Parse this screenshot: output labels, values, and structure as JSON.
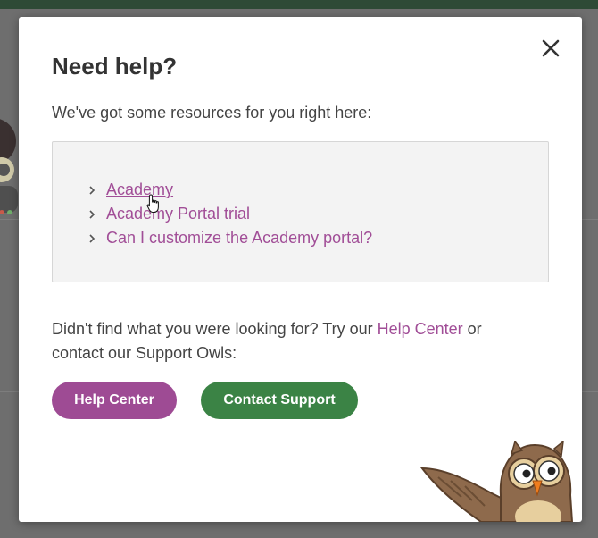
{
  "modal": {
    "title": "Need help?",
    "intro": "We've got some resources for you right here:",
    "resources": [
      {
        "label": "Academy"
      },
      {
        "label": "Academy Portal trial"
      },
      {
        "label": "Can I customize the Academy portal?"
      }
    ],
    "footer": {
      "text_before": "Didn't find what you were looking for? Try our ",
      "link_label": "Help Center",
      "text_after": " or contact our Support Owls:"
    },
    "buttons": {
      "help_center": "Help Center",
      "contact_support": "Contact Support"
    }
  },
  "colors": {
    "link": "#a14e97",
    "help_button": "#9e4b94",
    "contact_button": "#3b8345",
    "backdrop": "#6e6e6e"
  },
  "icons": [
    "close-icon",
    "chevron-right-icon",
    "hand-cursor-icon",
    "owl-mascot"
  ]
}
